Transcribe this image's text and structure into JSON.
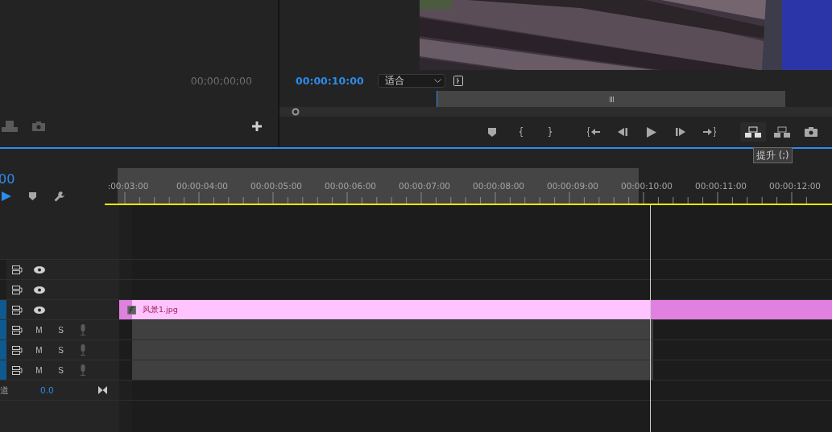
{
  "source_monitor": {
    "timecode": "00;00;00;00"
  },
  "program_monitor": {
    "timecode": "00:00:10:00",
    "zoom": "适合",
    "tooltip": "提升 (;)"
  },
  "timeline": {
    "timecode": "00",
    "ruler_labels": [
      ":00:03:00",
      "00:00:04:00",
      "00:00:05:00",
      "00:00:06:00",
      "00:00:07:00",
      "00:00:08:00",
      "00:00:09:00",
      "00:00:10:00",
      "00:00:11:00",
      "00:00:12:00"
    ],
    "tracks": [
      {
        "kind": "video",
        "targeted": false
      },
      {
        "kind": "video",
        "targeted": false
      },
      {
        "kind": "video",
        "targeted": true,
        "clip": "风景1.jpg"
      },
      {
        "kind": "audio",
        "targeted": true,
        "mute": "M",
        "solo": "S"
      },
      {
        "kind": "audio",
        "targeted": true,
        "mute": "M",
        "solo": "S"
      },
      {
        "kind": "audio",
        "targeted": true,
        "mute": "M",
        "solo": "S"
      }
    ],
    "master": {
      "label": "道",
      "value": "0.0"
    }
  }
}
